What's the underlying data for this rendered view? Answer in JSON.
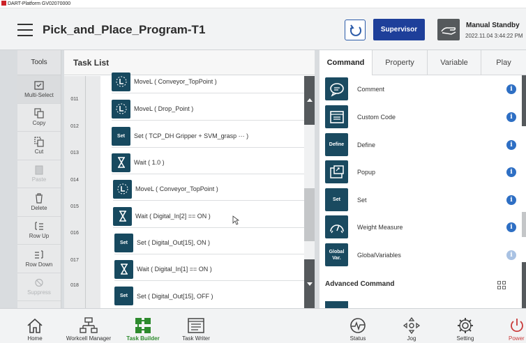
{
  "window": {
    "title": "DART-Platform GV02070000"
  },
  "header": {
    "program_title": "Pick_and_Place_Program-T1",
    "supervisor_label": "Supervisor",
    "mode_label": "Manual Standby",
    "mode_time": "2022.11.04 3:44:22 PM"
  },
  "tools": {
    "title": "Tools",
    "items": [
      {
        "label": "Multi-Select",
        "icon": "multi-select-icon"
      },
      {
        "label": "Copy",
        "icon": "copy-icon"
      },
      {
        "label": "Cut",
        "icon": "cut-icon"
      },
      {
        "label": "Paste",
        "icon": "paste-icon"
      },
      {
        "label": "Delete",
        "icon": "trash-icon"
      },
      {
        "label": "Row Up",
        "icon": "row-up-icon"
      },
      {
        "label": "Row Down",
        "icon": "row-down-icon"
      },
      {
        "label": "Suppress",
        "icon": "suppress-icon"
      }
    ]
  },
  "task_list": {
    "title": "Task List",
    "line_numbers": [
      "011",
      "012",
      "013",
      "014",
      "015",
      "016",
      "017",
      "018"
    ],
    "items": [
      {
        "icon": "movel-icon",
        "label": "MoveL ( Conveyor_TopPoint )"
      },
      {
        "icon": "movel-icon",
        "label": "MoveL ( Drop_Point )"
      },
      {
        "icon": "set-icon",
        "icon_text": "Set",
        "label": "Set ( TCP_DH Gripper + SVM_grasp ··· )"
      },
      {
        "icon": "wait-icon",
        "label": "Wait ( 1.0 )"
      },
      {
        "icon": "movel-icon",
        "label": "MoveL ( Conveyor_TopPoint )"
      },
      {
        "icon": "wait-icon",
        "label": "Wait ( Digital_In[2] == ON )"
      },
      {
        "icon": "set-icon",
        "icon_text": "Set",
        "label": "Set ( Digital_Out[15], ON )"
      },
      {
        "icon": "wait-icon",
        "label": "Wait ( Digital_In[1] == ON )"
      },
      {
        "icon": "set-icon",
        "icon_text": "Set",
        "label": "Set ( Digital_Out[15], OFF )"
      }
    ]
  },
  "command_panel": {
    "tabs": [
      "Command",
      "Property",
      "Variable",
      "Play"
    ],
    "commands": [
      {
        "icon": "comment-icon",
        "label": "Comment"
      },
      {
        "icon": "custom-code-icon",
        "label": "Custom Code"
      },
      {
        "icon": "define-icon",
        "icon_text": "Define",
        "label": "Define"
      },
      {
        "icon": "popup-icon",
        "label": "Popup"
      },
      {
        "icon": "set-icon",
        "icon_text": "Set",
        "label": "Set"
      },
      {
        "icon": "gauge-icon",
        "label": "Weight Measure"
      },
      {
        "icon": "global-var-icon",
        "icon_text": "Global Var.",
        "label": "GlobalVariables"
      }
    ],
    "advanced_title": "Advanced Command"
  },
  "bottom_nav": [
    {
      "label": "Home",
      "icon": "home-icon"
    },
    {
      "label": "Workcell Manager",
      "icon": "workcell-icon"
    },
    {
      "label": "Task Builder",
      "icon": "task-builder-icon"
    },
    {
      "label": "Task Writer",
      "icon": "task-writer-icon"
    },
    {
      "label": "Status",
      "icon": "status-icon"
    },
    {
      "label": "Jog",
      "icon": "jog-icon"
    },
    {
      "label": "Setting",
      "icon": "gear-icon"
    },
    {
      "label": "Power",
      "icon": "power-icon"
    }
  ],
  "colors": {
    "accent": "#1e3f9a",
    "icon_bg": "#17495f",
    "active_nav": "#2d8a2d",
    "info": "#2e6fc4",
    "power": "#c93a3a"
  }
}
